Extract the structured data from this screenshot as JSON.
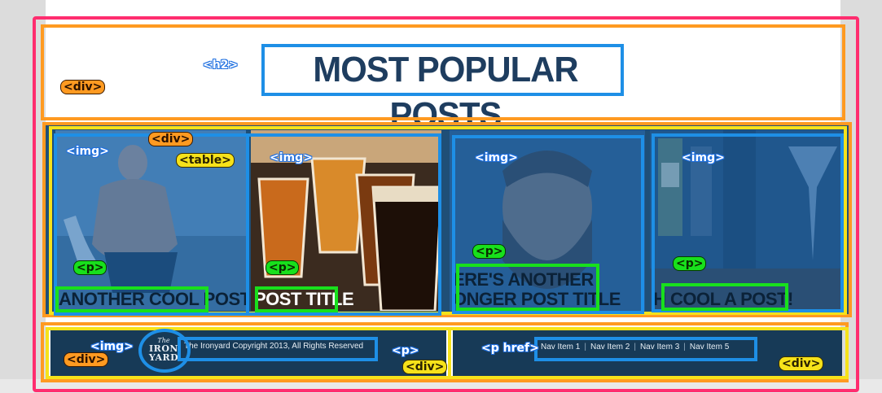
{
  "heading": "MOST POPULAR POSTS",
  "posts": [
    {
      "title": "ANOTHER COOL POST"
    },
    {
      "title": "POST TITLE"
    },
    {
      "title_line1": "ERE'S ANOTHER",
      "title_line2": "ONGER POST TITLE"
    },
    {
      "title": "H COOL A POST!"
    }
  ],
  "footer": {
    "logo_top": "The",
    "logo_mid": "IRON",
    "logo_bottom": "YARD",
    "copyright": "The Ironyard Copyright 2013, All Rights Reserved",
    "nav": [
      "Nav Item 1",
      "Nav Item 2",
      "Nav Item 3",
      "Nav Item 5"
    ]
  },
  "labels": {
    "h2": "<h2>",
    "div": "<div>",
    "img": "<img>",
    "table": "<table>",
    "p": "<p>",
    "p_href": "<p href>"
  },
  "colors": {
    "outer_outline": "#ff2d6f",
    "div_outline": "#ff9a21",
    "table_outline": "#f6e21a",
    "img_outline": "#1e8fe6",
    "p_outline": "#18e01c",
    "heading_text": "#1e3d5f",
    "footer_bg": "#173a57"
  }
}
